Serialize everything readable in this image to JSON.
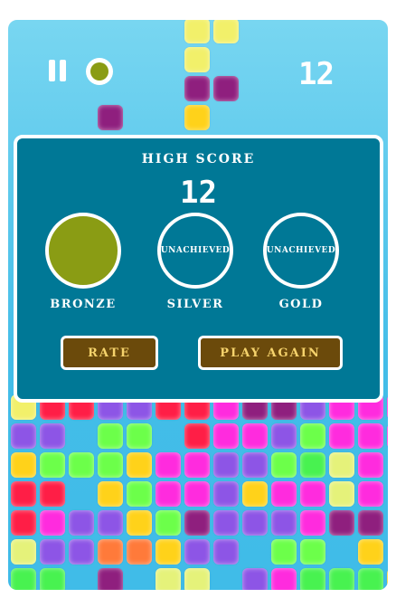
{
  "hud": {
    "score": "12",
    "pause_icon": "pause-icon",
    "coin_color": "#8a9c14"
  },
  "dialog": {
    "title": "HIGH SCORE",
    "high_score": "12",
    "medals": [
      {
        "label": "BRONZE",
        "state": "",
        "achieved": true,
        "color": "#8a9c14"
      },
      {
        "label": "SILVER",
        "state": "UNACHIEVED",
        "achieved": false
      },
      {
        "label": "GOLD",
        "state": "UNACHIEVED",
        "achieved": false
      }
    ],
    "buttons": {
      "rate": "RATE",
      "play_again": "PLAY AGAIN"
    }
  },
  "colors": {
    "dialog_bg": "#007896",
    "button_bg": "#6b4a0b",
    "button_text": "#f6d36c",
    "sky_top": "#78d6f1",
    "sky_bottom": "#40bce8"
  }
}
